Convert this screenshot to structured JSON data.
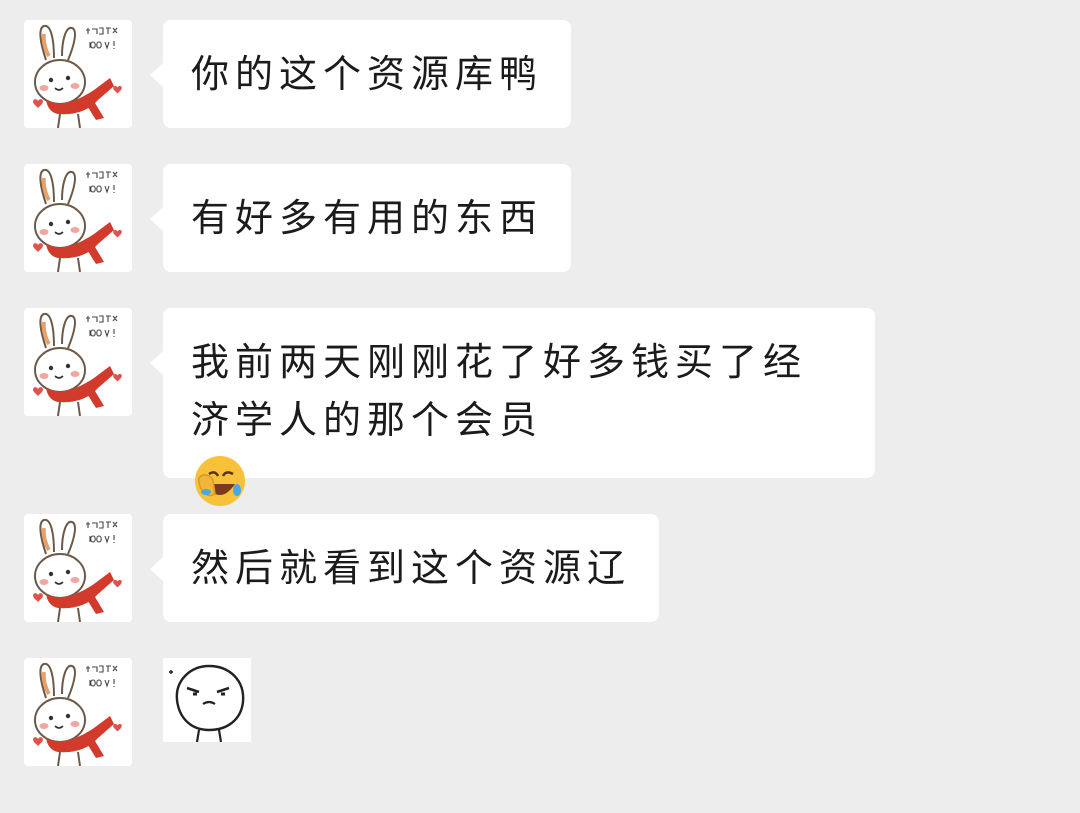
{
  "messages": [
    {
      "text": "你的这个资源库鸭"
    },
    {
      "text": "有好多有用的东西"
    },
    {
      "lines": [
        "我前两天刚刚花了好多钱买了经",
        "济学人的那个会员"
      ],
      "emoji": "face-with-hand-over-face-laughing-emoji"
    },
    {
      "text": "然后就看到这个资源辽"
    },
    {
      "sticker": "smirking-blob-sticker"
    }
  ],
  "avatar": {
    "icon": "bunny-with-red-scarf-avatar",
    "handwritten_text": "你也最喜欢100哇！"
  },
  "colors": {
    "background": "#ededed",
    "bubble": "#ffffff",
    "text": "#1b1b1b",
    "scarf": "#d23a2b",
    "emoji": "#f7c23a"
  }
}
